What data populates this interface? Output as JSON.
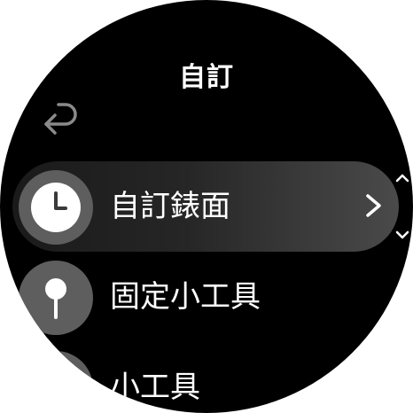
{
  "header": {
    "title": "自訂"
  },
  "back_button": {
    "icon": "back-arrow-icon"
  },
  "menu": {
    "items": [
      {
        "label": "自訂錶面",
        "icon": "clock-icon",
        "selected": true,
        "has_chevron": true
      },
      {
        "label": "固定小工具",
        "icon": "pin-icon",
        "selected": false,
        "has_chevron": false
      },
      {
        "label": "小工具",
        "icon": "widget-icon",
        "selected": false,
        "has_chevron": false
      }
    ]
  },
  "colors": {
    "background": "#000000",
    "icon_circle": "#5e5e5e",
    "text": "#ffffff",
    "back_icon": "#8a8a8a"
  }
}
